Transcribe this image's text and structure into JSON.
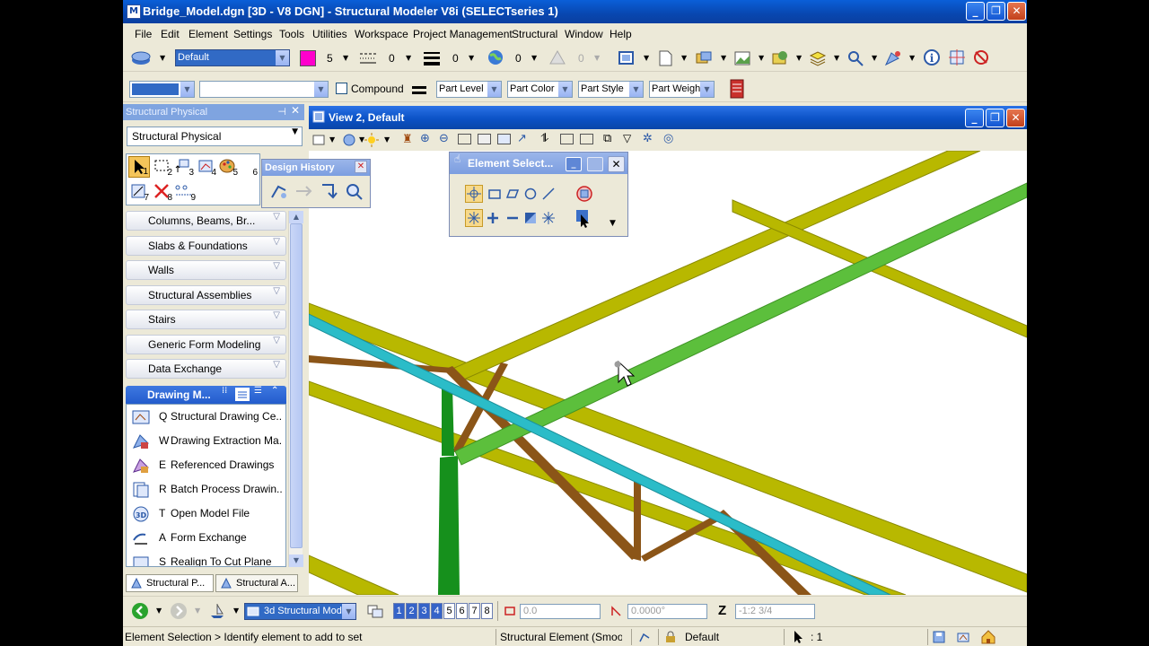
{
  "window": {
    "title": "Bridge_Model.dgn [3D - V8 DGN] - Structural Modeler V8i (SELECTseries 1)",
    "buttons": [
      "minimize",
      "restore",
      "close"
    ]
  },
  "menu": [
    "File",
    "Edit",
    "Element",
    "Settings",
    "Tools",
    "Utilities",
    "Workspace",
    "Project Management",
    "Structural",
    "Window",
    "Help"
  ],
  "toolbar1": {
    "level": "Default",
    "color_value": "5",
    "color_swatch": "#ff00cc",
    "style_value": "0",
    "weight_value": "0",
    "transparency_value": "0",
    "priority_value": "0"
  },
  "toolbar2": {
    "compound_label": "Compound",
    "part_level": "Part Level",
    "part_color": "Part Color",
    "part_style": "Part Style",
    "part_weight": "Part Weigh"
  },
  "panel": {
    "title": "Structural Physical",
    "task_dropdown": "Structural Physical",
    "tool_numbers": [
      "1",
      "2",
      "3",
      "4",
      "5",
      "6",
      "7",
      "8",
      "9"
    ],
    "sections": [
      "Columns, Beams, Br...",
      "Slabs & Foundations",
      "Walls",
      "Structural Assemblies",
      "Stairs",
      "Generic Form Modeling",
      "Data Exchange"
    ],
    "active_section": "Drawing M...",
    "items": [
      {
        "key": "Q",
        "label": "Structural Drawing Ce..."
      },
      {
        "key": "W",
        "label": "Drawing Extraction Ma..."
      },
      {
        "key": "E",
        "label": "Referenced Drawings"
      },
      {
        "key": "R",
        "label": "Batch Process Drawin..."
      },
      {
        "key": "T",
        "label": "Open Model File"
      },
      {
        "key": "A",
        "label": "Form Exchange"
      },
      {
        "key": "S",
        "label": "Realign To Cut Plane"
      }
    ],
    "tabs": [
      "Structural P...",
      "Structural A..."
    ]
  },
  "design_history": {
    "title": "Design History"
  },
  "element_selection": {
    "title": "Element Select..."
  },
  "view": {
    "title": "View 2, Default"
  },
  "bottom_bar": {
    "view_group": "3d Structural Mod",
    "view_numbers": [
      "1",
      "2",
      "3",
      "4",
      "5",
      "6",
      "7",
      "8"
    ],
    "active_views": [
      1,
      2,
      3,
      4
    ],
    "x_field": "0.0",
    "angle_field": "0.0000°",
    "z_label": "Z",
    "z_field": "-1:2 3/4"
  },
  "status": {
    "prompt": "Element Selection > Identify element to add to set",
    "element_type": "Structural Element (Smooth) \\",
    "active_level": "Default",
    "selection_count": ": 1"
  },
  "colors": {
    "yellow_beam": "#b8b800",
    "green_beam": "#5cbf3c",
    "cyan_beam": "#2bbcc8",
    "brown_brace": "#8b5518",
    "green_column": "#16901c"
  }
}
